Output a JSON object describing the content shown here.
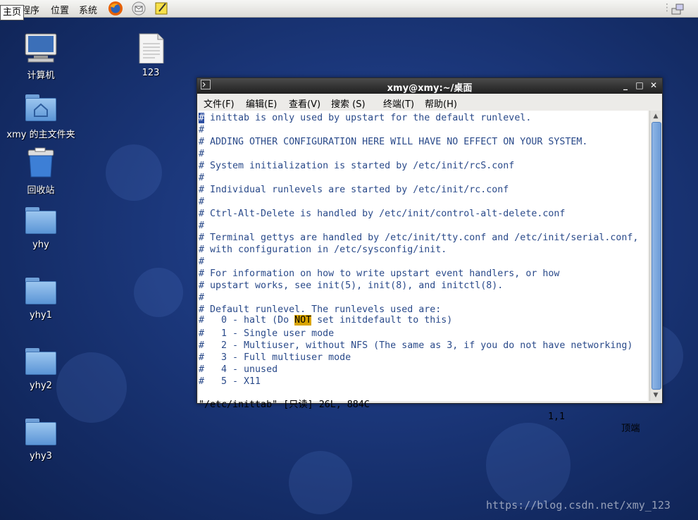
{
  "panel": {
    "menus": [
      "程序",
      "位置",
      "系统"
    ],
    "tooltip": "主页"
  },
  "desktop": {
    "icons": [
      {
        "label": "计算机"
      },
      {
        "label": "123"
      },
      {
        "label": "xmy 的主文件夹"
      },
      {
        "label": "回收站"
      },
      {
        "label": "yhy"
      },
      {
        "label": "yhy1"
      },
      {
        "label": "yhy2"
      },
      {
        "label": "yhy3"
      }
    ]
  },
  "terminal": {
    "title": "xmy@xmy:~/桌面",
    "menus": [
      "文件(F)",
      "编辑(E)",
      "查看(V)",
      "搜索 (S)",
      "终端(T)",
      "帮助(H)"
    ],
    "lines": [
      "# inittab is only used by upstart for the default runlevel.",
      "#",
      "# ADDING OTHER CONFIGURATION HERE WILL HAVE NO EFFECT ON YOUR SYSTEM.",
      "#",
      "# System initialization is started by /etc/init/rcS.conf",
      "#",
      "# Individual runlevels are started by /etc/init/rc.conf",
      "#",
      "# Ctrl-Alt-Delete is handled by /etc/init/control-alt-delete.conf",
      "#",
      "# Terminal gettys are handled by /etc/init/tty.conf and /etc/init/serial.conf,",
      "# with configuration in /etc/sysconfig/init.",
      "#",
      "# For information on how to write upstart event handlers, or how",
      "# upstart works, see init(5), init(8), and initctl(8).",
      "#",
      "# Default runlevel. The runlevels used are:",
      "",
      "#   1 - Single user mode",
      "#   2 - Multiuser, without NFS (The same as 3, if you do not have networking)",
      "#   3 - Full multiuser mode",
      "#   4 - unused",
      "#   5 - X11"
    ],
    "halt_line": {
      "before": "#   0 - halt (Do ",
      "highlight": "NOT",
      "after": " set initdefault to this)"
    },
    "status": {
      "file": "\"/etc/inittab\" [只读] 26L, 884C",
      "position": "1,1",
      "scroll": "顶端"
    }
  },
  "watermark": "https://blog.csdn.net/xmy_123"
}
